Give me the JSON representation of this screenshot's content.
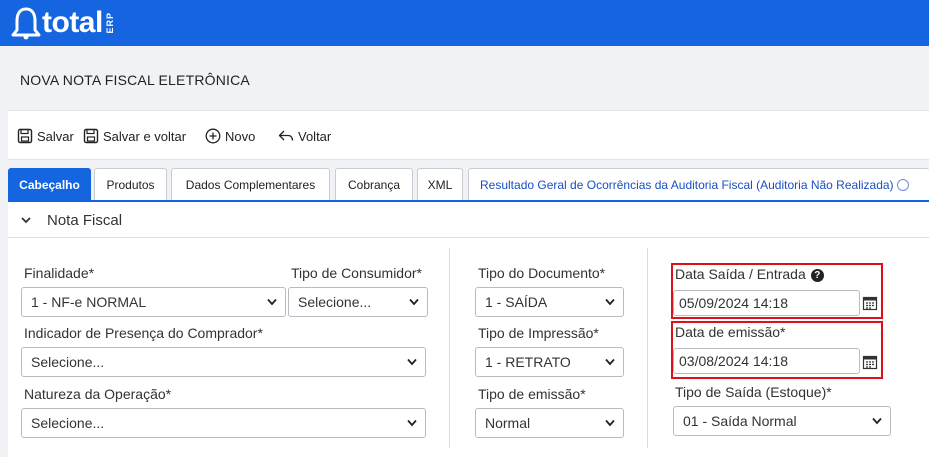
{
  "brand": {
    "name": "total",
    "suffix": "ERP"
  },
  "page": {
    "title": "NOVA NOTA FISCAL ELETRÔNICA"
  },
  "toolbar": {
    "save": "Salvar",
    "save_back": "Salvar e voltar",
    "new": "Novo",
    "back": "Voltar"
  },
  "tabs": [
    {
      "label": "Cabeçalho"
    },
    {
      "label": "Produtos"
    },
    {
      "label": "Dados Complementares"
    },
    {
      "label": "Cobrança"
    },
    {
      "label": "XML"
    },
    {
      "label": "Resultado Geral de Ocorrências da Auditoria Fiscal (Auditoria Não Realizada)"
    }
  ],
  "section": {
    "title": "Nota Fiscal"
  },
  "form": {
    "finalidade": {
      "label": "Finalidade*",
      "value": "1 - NF-e NORMAL"
    },
    "tipo_consumidor": {
      "label": "Tipo de Consumidor*",
      "value": "Selecione..."
    },
    "indicador_presenca": {
      "label": "Indicador de Presença do Comprador*",
      "value": "Selecione..."
    },
    "natureza_operacao": {
      "label": "Natureza da Operação*",
      "value": "Selecione..."
    },
    "tipo_documento": {
      "label": "Tipo do Documento*",
      "value": "1 - SAÍDA"
    },
    "tipo_impressao": {
      "label": "Tipo de Impressão*",
      "value": "1 - RETRATO"
    },
    "tipo_emissao": {
      "label": "Tipo de emissão*",
      "value": "Normal"
    },
    "data_saida": {
      "label": "Data Saída / Entrada",
      "help": "?",
      "value": "05/09/2024 14:18"
    },
    "data_emissao": {
      "label": "Data de emissão*",
      "value": "03/08/2024 14:18"
    },
    "tipo_saida": {
      "label": "Tipo de Saída (Estoque)*",
      "value": "01 - Saída Normal"
    }
  },
  "colors": {
    "brand": "#1565e0",
    "highlight": "#e0101a"
  }
}
